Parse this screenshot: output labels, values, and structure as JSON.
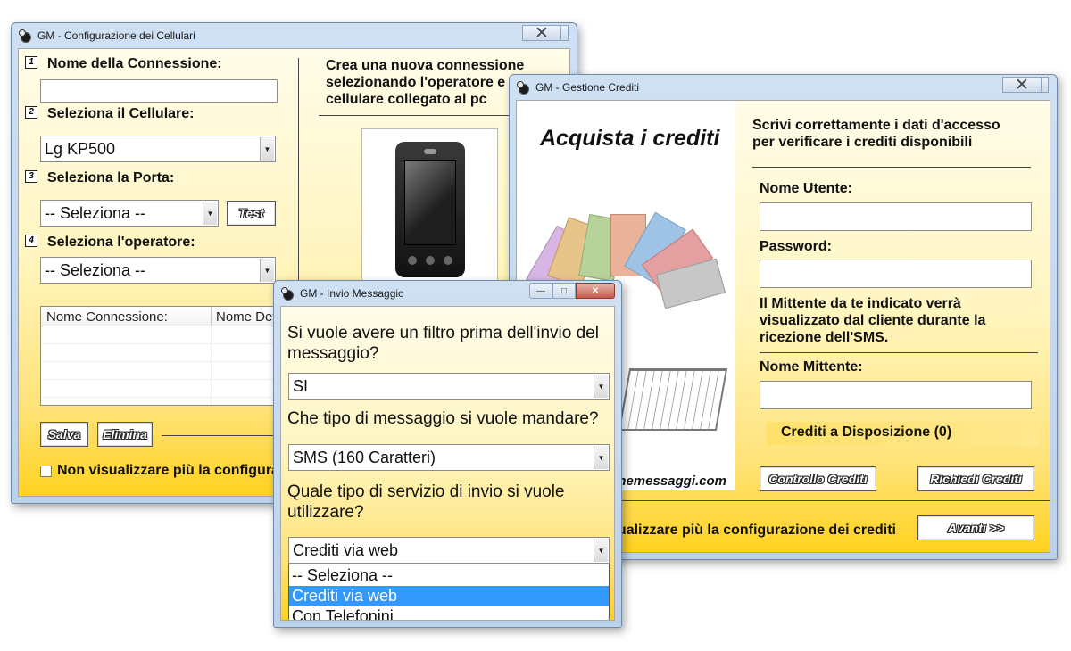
{
  "config_window": {
    "title": "GM - Configurazione dei Cellulari",
    "step_numbers": [
      "1",
      "2",
      "3",
      "4"
    ],
    "connection_name_label": "Nome della Connessione:",
    "connection_name_value": "",
    "phone_label": "Seleziona il Cellulare:",
    "phone_value": "Lg KP500",
    "port_label": "Seleziona la Porta:",
    "port_value": "-- Seleziona --",
    "test_button": "Test",
    "operator_label": "Seleziona l'operatore:",
    "operator_value": "-- Seleziona --",
    "intro_text": "Crea una nuova connessione selezionando l'operatore e il cellulare collegato al pc",
    "table_columns": [
      "Nome Connessione:",
      "Nome Dev"
    ],
    "save_button": "Salva",
    "delete_button": "Elimina",
    "dont_show_label": "Non visualizzare più la configurazione"
  },
  "credits_window": {
    "title": "GM - Gestione Crediti",
    "banner_title": "Acquista i crediti",
    "banner_site": "www.gestionemessaggi.com",
    "intro_text": "Scrivi correttamente i dati d'accesso per verificare i crediti disponibili",
    "username_label": "Nome Utente:",
    "username_value": "",
    "password_label": "Password:",
    "password_value": "",
    "sender_info": "Il Mittente da te indicato verrà visualizzato dal cliente durante la ricezione dell'SMS.",
    "sender_label": "Nome Mittente:",
    "sender_value": "",
    "available_credits": "Crediti a Disposizione (0)",
    "check_button": "Controllo Crediti",
    "request_button": "Richiedi Crediti",
    "dont_show_label": "Non visualizzare più la configurazione dei crediti",
    "next_button": "Avanti >>"
  },
  "message_window": {
    "title": "GM - Invio Messaggio",
    "q1": "Si vuole avere un filtro prima dell'invio del messaggio?",
    "q1_value": "SI",
    "q2": "Che tipo di messaggio si vuole mandare?",
    "q2_value": "SMS (160 Caratteri)",
    "q3": "Quale tipo di servizio di invio si vuole utilizzare?",
    "q3_value": "Crediti via web",
    "q3_options": [
      "-- Seleziona --",
      "Crediti via web",
      "Con Telefonini"
    ]
  },
  "colors": {
    "highlight": "#3399ff",
    "gradient_end": "#ffd21f"
  }
}
